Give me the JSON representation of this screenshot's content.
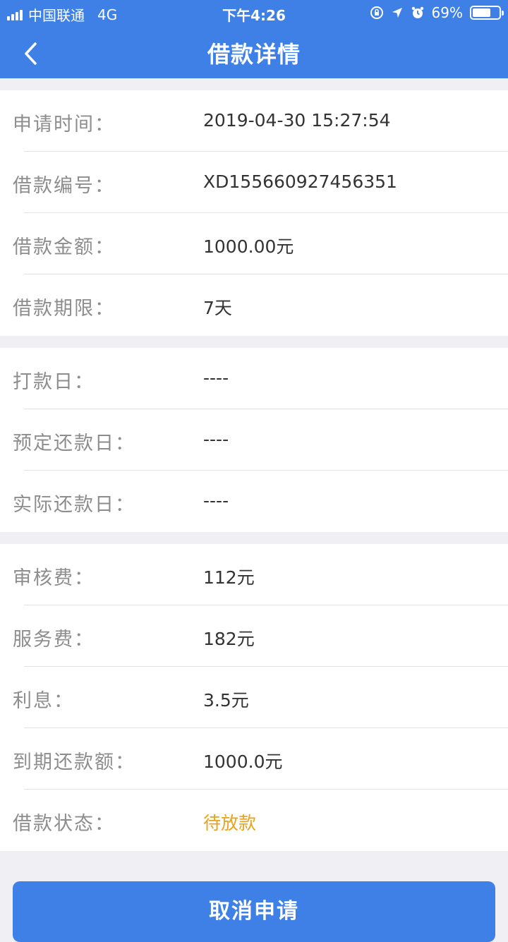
{
  "status_bar": {
    "carrier": "中国联通",
    "network": "4G",
    "time": "下午4:26",
    "battery_percent": "69%",
    "battery_level": 0.69,
    "icons": [
      "signal-icon",
      "orientation-lock-icon",
      "location-arrow-icon",
      "alarm-icon",
      "battery-icon"
    ]
  },
  "header": {
    "title": "借款详情",
    "back_icon": "chevron-left-icon"
  },
  "sections": [
    {
      "rows": [
        {
          "label": "申请时间：",
          "value": "2019-04-30 15:27:54"
        },
        {
          "label": "借款编号：",
          "value": "XD155660927456351"
        },
        {
          "label": "借款金额：",
          "value": "1000.00元"
        },
        {
          "label": "借款期限：",
          "value": "7天"
        }
      ]
    },
    {
      "rows": [
        {
          "label": "打款日：",
          "value": "----"
        },
        {
          "label": "预定还款日：",
          "value": "----"
        },
        {
          "label": "实际还款日：",
          "value": "----"
        }
      ]
    },
    {
      "rows": [
        {
          "label": "审核费：",
          "value": "112元"
        },
        {
          "label": "服务费：",
          "value": "182元"
        },
        {
          "label": "利息：",
          "value": "3.5元"
        },
        {
          "label": "到期还款额：",
          "value": "1000.0元"
        },
        {
          "label": "借款状态：",
          "value": "待放款"
        }
      ]
    }
  ],
  "action": {
    "cancel_label": "取消申请"
  },
  "colors": {
    "accent": "#3f80e6",
    "status_pending": "#e9a21c",
    "label": "#8d8d8d",
    "value": "#333333",
    "background": "#efeff4"
  }
}
